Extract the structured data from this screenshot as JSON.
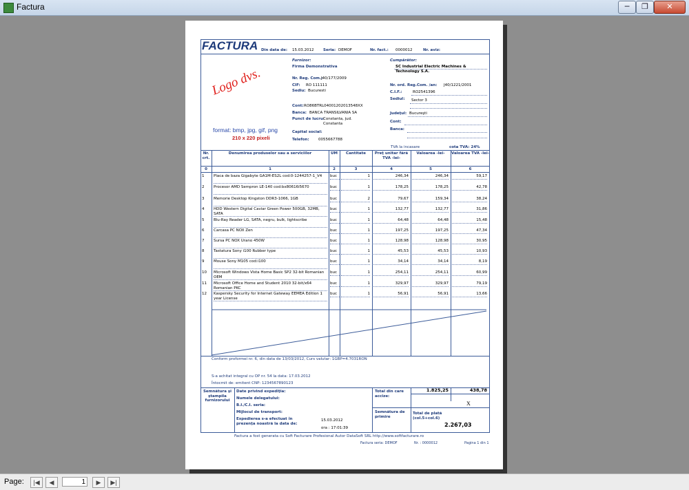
{
  "window": {
    "title": "Factura",
    "btn_min": "─",
    "btn_max": "❐",
    "btn_close": "✕"
  },
  "status": {
    "page_label": "Page:",
    "page_number": "1",
    "first": "|◀",
    "prev": "◀",
    "next": "▶",
    "last": "▶|"
  },
  "invoice": {
    "title": "FACTURA",
    "date_label": "Din data de:",
    "date": "15.03.2012",
    "series_label": "Seria:",
    "series": "DEMOF",
    "number_label": "Nr. fact.:",
    "number": "0000012",
    "notice_label": "Nr. aviz:",
    "logo_text": "Logo dvs.",
    "logo_format": "format: bmp, jpg, gif, png",
    "logo_size": "210 x 220 pixeli",
    "supplier": {
      "title": "Furnizor:",
      "name": "Firma Demonstrativa",
      "regcom_label": "Nr. Reg. Com.:",
      "regcom": "J40/177/2009",
      "cif_label": "CIF:",
      "cif": "RO 111111",
      "sediu_label": "Sediu:",
      "sediu": "Bucuresti",
      "cont_label": "Cont:",
      "cont": "RO86BTRL04001202013548XX",
      "banca_label": "Banca:",
      "banca": "BANCA TRANSILVANIA SA",
      "punct_label": "Punct de lucru:",
      "punct": "Constanta, jud. Constanta",
      "capital_label": "Capital social:",
      "tel_label": "Telefon:",
      "tel": "0055667788"
    },
    "buyer": {
      "title": "Cumpărător:",
      "name": "SC Industrial Electric Machines & Technology S.A.",
      "regcom_label": "Nr. ord. Reg.Com. /an:",
      "regcom": "J40/1221/2001",
      "cif_label": "C.I.F.:",
      "cif": "RO2541396",
      "sediu_label": "Sediul:",
      "sediu": "Sector 3",
      "judet_label": "Judeţul:",
      "judet": "Bucureşti",
      "cont_label": "Cont:",
      "banca_label": "Banca:"
    },
    "tva_label": "TVA la incasare",
    "vat_rate": "cota TVA: 24%",
    "columns": [
      "Nr. crt.",
      "Denumirea produselor sau a serviciilor",
      "UM",
      "Cantitate",
      "Preţ unitar fără TVA -lei-",
      "Valoarea -lei-",
      "Valoarea TVA -lei-"
    ],
    "column_numbers": [
      "0",
      "1",
      "2",
      "3",
      "4",
      "5",
      "6"
    ],
    "items": [
      {
        "nr": "1",
        "name": "Placa de baza Gigabyte GA1M-ES2L cod:0-1244257-1_V4",
        "um": "buc",
        "qty": "1",
        "price": "246,34",
        "value": "246,34",
        "vat": "59,17"
      },
      {
        "nr": "2",
        "name": "Procesor AMD Sempron LE-140 cod:bx80616i5670",
        "um": "buc",
        "qty": "1",
        "price": "178,25",
        "value": "178,25",
        "vat": "42,78"
      },
      {
        "nr": "3",
        "name": "Memorie Desktop Kingston DDR3-1066, 1GB",
        "um": "buc",
        "qty": "2",
        "price": "79,67",
        "value": "159,34",
        "vat": "38,24"
      },
      {
        "nr": "4",
        "name": "HDD Western Digital Caviar Green Power 500GB, 32MB, SATA",
        "um": "buc",
        "qty": "1",
        "price": "132,77",
        "value": "132,77",
        "vat": "31,86"
      },
      {
        "nr": "5",
        "name": "Blu-Ray Reader LG, SATA, negru, bulk, lightscribe",
        "um": "buc",
        "qty": "1",
        "price": "64,48",
        "value": "64,48",
        "vat": "15,48"
      },
      {
        "nr": "6",
        "name": "Carcasa PC NOX Zen",
        "um": "buc",
        "qty": "1",
        "price": "197,25",
        "value": "197,25",
        "vat": "47,34"
      },
      {
        "nr": "7",
        "name": "Sursa PC NOX Urano 450W",
        "um": "buc",
        "qty": "1",
        "price": "128,98",
        "value": "128,98",
        "vat": "30,95"
      },
      {
        "nr": "8",
        "name": "Tastatura Sony i100 Rubber type",
        "um": "buc",
        "qty": "1",
        "price": "45,53",
        "value": "45,53",
        "vat": "10,93"
      },
      {
        "nr": "9",
        "name": "Mouse Sony M105 cod:i100",
        "um": "buc",
        "qty": "1",
        "price": "34,14",
        "value": "34,14",
        "vat": "8,19"
      },
      {
        "nr": "10",
        "name": "Microsoft Windows Vista Home Basic SP2 32-bit Romanian OEM",
        "um": "buc",
        "qty": "1",
        "price": "254,11",
        "value": "254,11",
        "vat": "60,99"
      },
      {
        "nr": "11",
        "name": "Microsoft Office Home and Student 2010 32-bit/x64 Romanian PKC",
        "um": "buc",
        "qty": "1",
        "price": "329,97",
        "value": "329,97",
        "vat": "79,19"
      },
      {
        "nr": "12",
        "name": "Kaspersky Security for Internet Gateway EEMEA Edition 1 year License",
        "um": "buc",
        "qty": "1",
        "price": "56,91",
        "value": "56,91",
        "vat": "13,66"
      }
    ],
    "proforma_note": "Conform proformei nr. 6, din data de 13/03/2012, Curs valutar: 1GBP=4.7031RON",
    "payment_note": "S-a achitat integral cu OP nr. 54 la data: 17.03.2012",
    "issuer_note": "Întocmit de: emitent  CNP: 1234567890123",
    "footer": {
      "sign_supplier": "Semnătura şi ştampila furnizorului",
      "shipping_title": "Date privind expediţia:",
      "delegate_label": "Numele delegatului:",
      "id_label": "B.I./C.I. seria:",
      "transport_label": "Mijlocul de transport:",
      "shipped_label": "Expedierea s-a efectuat în prezenţa noastră la data de:",
      "ship_date": "15.03.2012",
      "ship_time": "ora : 17:01:39",
      "total_label": "Total din care accize:",
      "total_value": "1.825,25",
      "total_vat": "438,78",
      "excise_mark": "X",
      "sign_buyer": "Semnătura de primire",
      "pay_label": "Total de plată (col.5+col.6)",
      "pay_value": "2.267,03"
    },
    "bottom_note": "Factura a fost generata cu Soft Facturare Profesional Autor DataSoft SRL http://www.softfacturare.ro",
    "bottom_series": "Factura seria:  DEMOF",
    "bottom_number": "Nr. : 0000012",
    "bottom_page": "Pagina 1 din 1"
  }
}
